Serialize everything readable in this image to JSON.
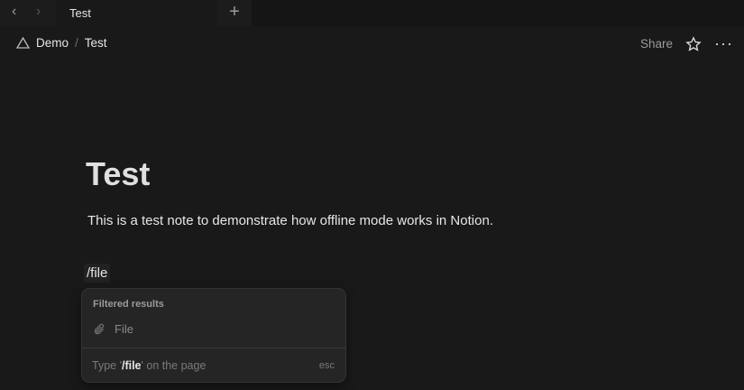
{
  "tabbar": {
    "tab_label": "Test",
    "back_icon": "chevron-left",
    "forward_icon": "chevron-right",
    "new_tab_icon": "plus"
  },
  "breadcrumb": {
    "workspace": "Demo",
    "separator": "/",
    "page": "Test"
  },
  "topbar": {
    "share_label": "Share",
    "star_icon": "star",
    "more_icon": "ellipsis"
  },
  "page": {
    "title": "Test",
    "paragraph": "This is a test note to demonstrate how offline mode works in Notion.",
    "command_text": "/file"
  },
  "menu": {
    "header": "Filtered results",
    "items": [
      {
        "label": "File",
        "icon": "paperclip"
      }
    ],
    "footer_prefix": "Type '",
    "footer_command": "/file",
    "footer_suffix": "' on the page",
    "esc_label": "esc"
  }
}
